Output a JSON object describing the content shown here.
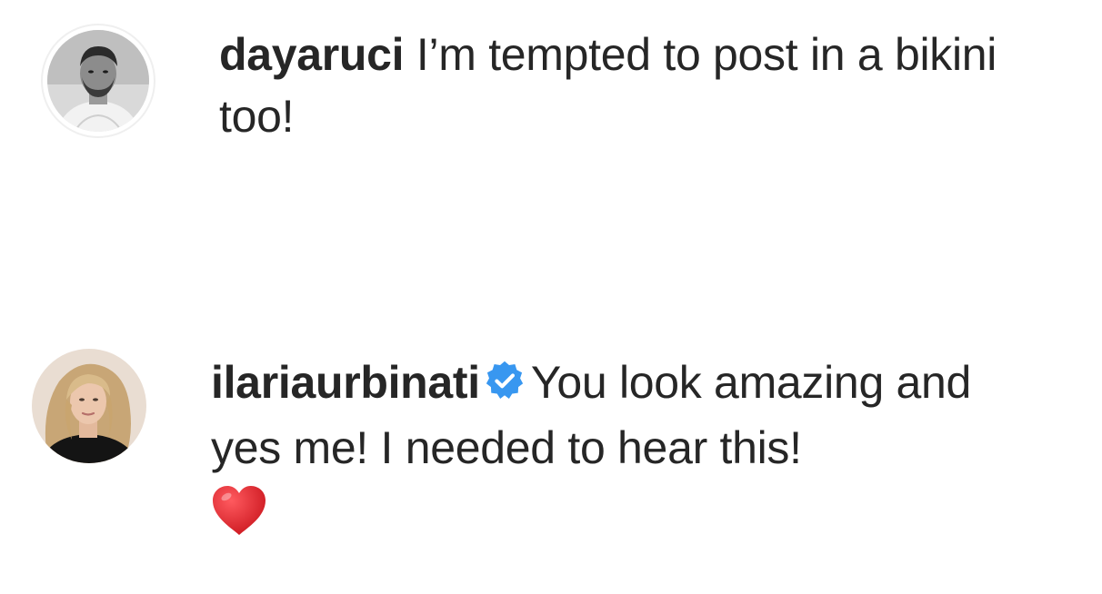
{
  "comments": [
    {
      "username": "dayaruci",
      "text": " I’m tempted to post in a bikini too!",
      "verified": false
    },
    {
      "username": "ilariaurbinati",
      "text": "You look amazing and yes me! I needed to hear this!",
      "verified": true,
      "emoji": "heart-emoji"
    }
  ],
  "colors": {
    "text": "#262626",
    "verified_badge": "#3897f0",
    "heart": "#e0262f",
    "avatar_ring": "#efefef"
  }
}
